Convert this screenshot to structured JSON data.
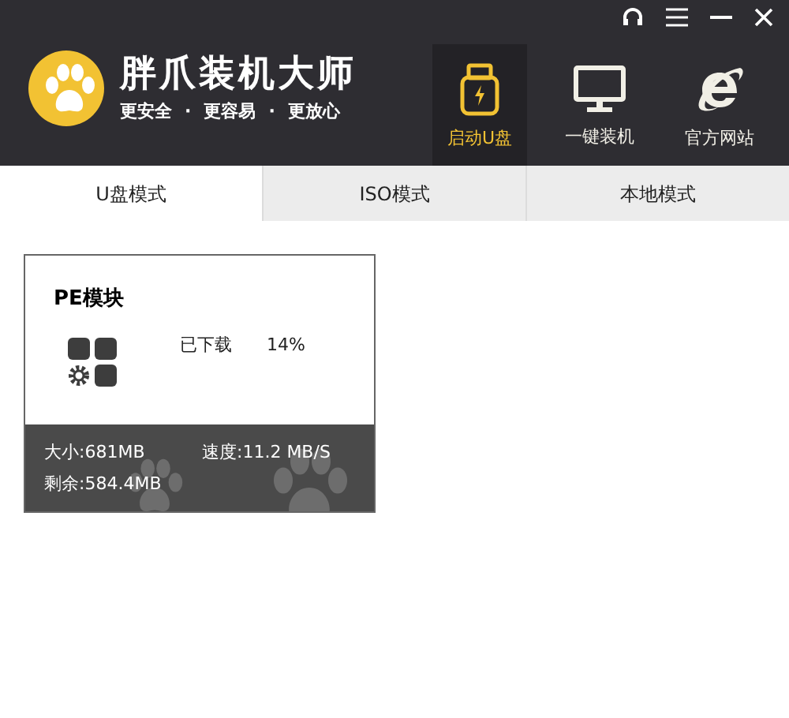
{
  "header": {
    "title": "胖爪装机大师",
    "slogans": [
      "更安全",
      "·",
      "更容易",
      "·",
      "更放心"
    ]
  },
  "nav": [
    {
      "kind": "usb",
      "label": "启动U盘",
      "selected": true
    },
    {
      "kind": "monitor",
      "label": "一键装机",
      "selected": false
    },
    {
      "kind": "browser",
      "label": "官方网站",
      "selected": false
    }
  ],
  "tabs": [
    {
      "label": "U盘模式",
      "selected": true
    },
    {
      "label": "ISO模式",
      "selected": false
    },
    {
      "label": "本地模式",
      "selected": false
    }
  ],
  "module": {
    "title": "PE模块",
    "status": "已下载",
    "percent": "14%",
    "size": "大小:681MB",
    "speed": "速度:11.2 MB/S",
    "remaining": "剩余:584.4MB"
  }
}
